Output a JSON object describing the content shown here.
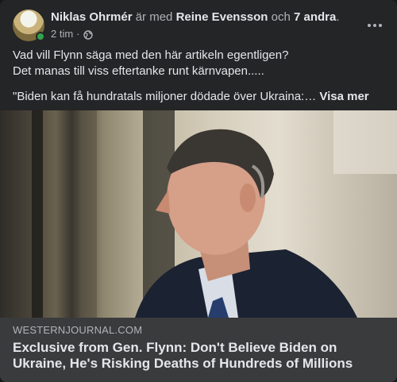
{
  "post": {
    "author": "Niklas Ohrmér",
    "with_text": " är med ",
    "tagged": "Reine Evensson",
    "and_text": " och ",
    "others": "7 andra",
    "period": ".",
    "time": "2 tim",
    "separator": " · ",
    "privacy_icon": "globe-icon",
    "text_line1": "Vad vill Flynn säga med den här artikeln egentligen?",
    "text_line2": "Det manas till viss eftertanke runt kärnvapen.....",
    "quote": "\"Biden kan få hundratals miljoner dödade över Ukraina:… ",
    "see_more": "Visa mer"
  },
  "link": {
    "domain": "WESTERNJOURNAL.COM",
    "headline": "Exclusive from Gen. Flynn: Don't Believe Biden on Ukraine, He's Risking Deaths of Hundreds of Millions"
  },
  "colors": {
    "card": "#242526",
    "preview": "#3a3b3c",
    "online": "#31a24c",
    "text_primary": "#e4e6eb",
    "text_secondary": "#b0b3b8"
  }
}
